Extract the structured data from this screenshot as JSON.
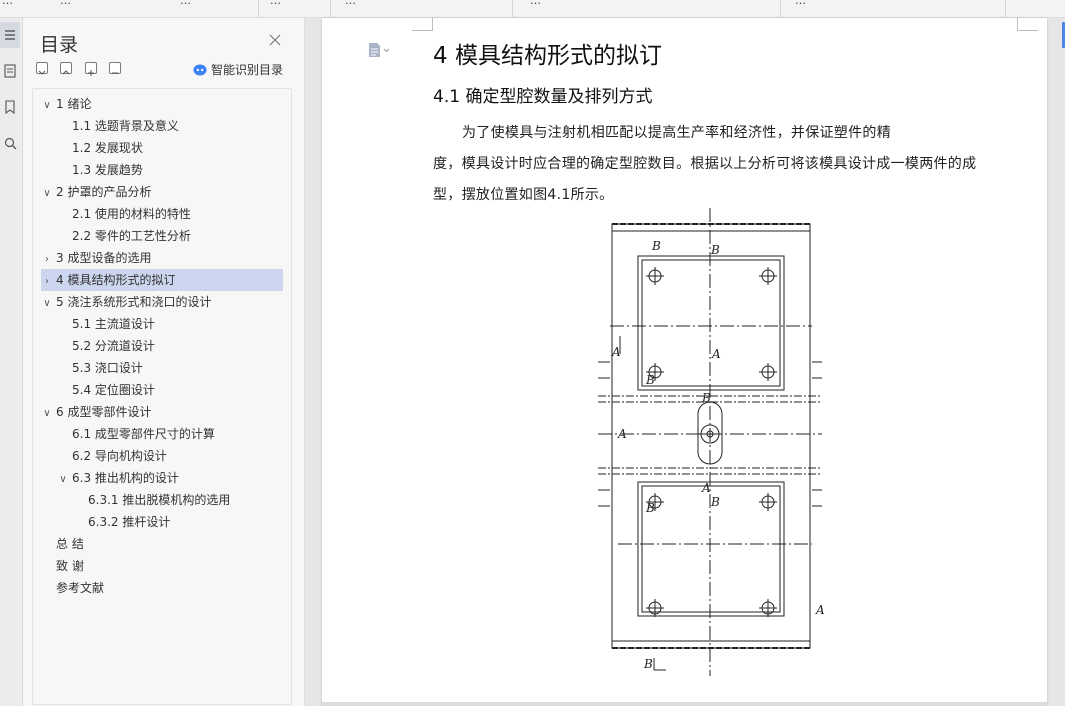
{
  "toolbar": {
    "fragments": [
      "…",
      "…",
      "…",
      "…",
      "…",
      "…",
      "…"
    ]
  },
  "toc": {
    "title": "目录",
    "smart_label": "智能识别目录",
    "items": [
      {
        "label": "1 绪论",
        "level": 0,
        "arrow": "down"
      },
      {
        "label": "1.1  选题背景及意义",
        "level": 1
      },
      {
        "label": "1.2  发展现状",
        "level": 1
      },
      {
        "label": "1.3  发展趋势",
        "level": 1
      },
      {
        "label": "2 护罩的产品分析",
        "level": 0,
        "arrow": "down"
      },
      {
        "label": "2.1 使用的材料的特性",
        "level": 1
      },
      {
        "label": "2.2 零件的工艺性分析",
        "level": 1
      },
      {
        "label": "3 成型设备的选用",
        "level": 0,
        "arrow": "right"
      },
      {
        "label": "4 模具结构形式的拟订",
        "level": 0,
        "arrow": "right",
        "selected": true
      },
      {
        "label": "5 浇注系统形式和浇口的设计",
        "level": 0,
        "arrow": "down"
      },
      {
        "label": "5.1 主流道设计",
        "level": 1
      },
      {
        "label": "5.2 分流道设计",
        "level": 1
      },
      {
        "label": "5.3 浇口设计",
        "level": 1
      },
      {
        "label": "5.4 定位圈设计",
        "level": 1
      },
      {
        "label": "6 成型零部件设计",
        "level": 0,
        "arrow": "down"
      },
      {
        "label": "6.1 成型零部件尺寸的计算",
        "level": 1
      },
      {
        "label": "6.2 导向机构设计",
        "level": 1
      },
      {
        "label": "6.3 推出机构的设计",
        "level": 1,
        "arrow": "down"
      },
      {
        "label": "6.3.1 推出脱模机构的选用",
        "level": 2
      },
      {
        "label": "6.3.2 推杆设计",
        "level": 2
      },
      {
        "label": "总   结",
        "level": 0
      },
      {
        "label": "致  谢",
        "level": 0
      },
      {
        "label": "参考文献",
        "level": 0
      }
    ]
  },
  "document": {
    "heading1": "4 模具结构形式的拟订",
    "heading2": "4.1 确定型腔数量及排列方式",
    "paragraph_lines": [
      "为了使模具与注射机相匹配以提高生产率和经济性，并保证塑件的精",
      "度，模具设计时应合理的确定型腔数目。根据以上分析可将该模具设计成一模两件的成",
      "型，摆放位置如图4.1所示。"
    ],
    "figure_labels": {
      "b": "B",
      "a": "A"
    }
  },
  "colors": {
    "selected_bg": "#ccd6ef",
    "accent": "#4a86e8",
    "panel_bg": "#f7f7f7"
  }
}
